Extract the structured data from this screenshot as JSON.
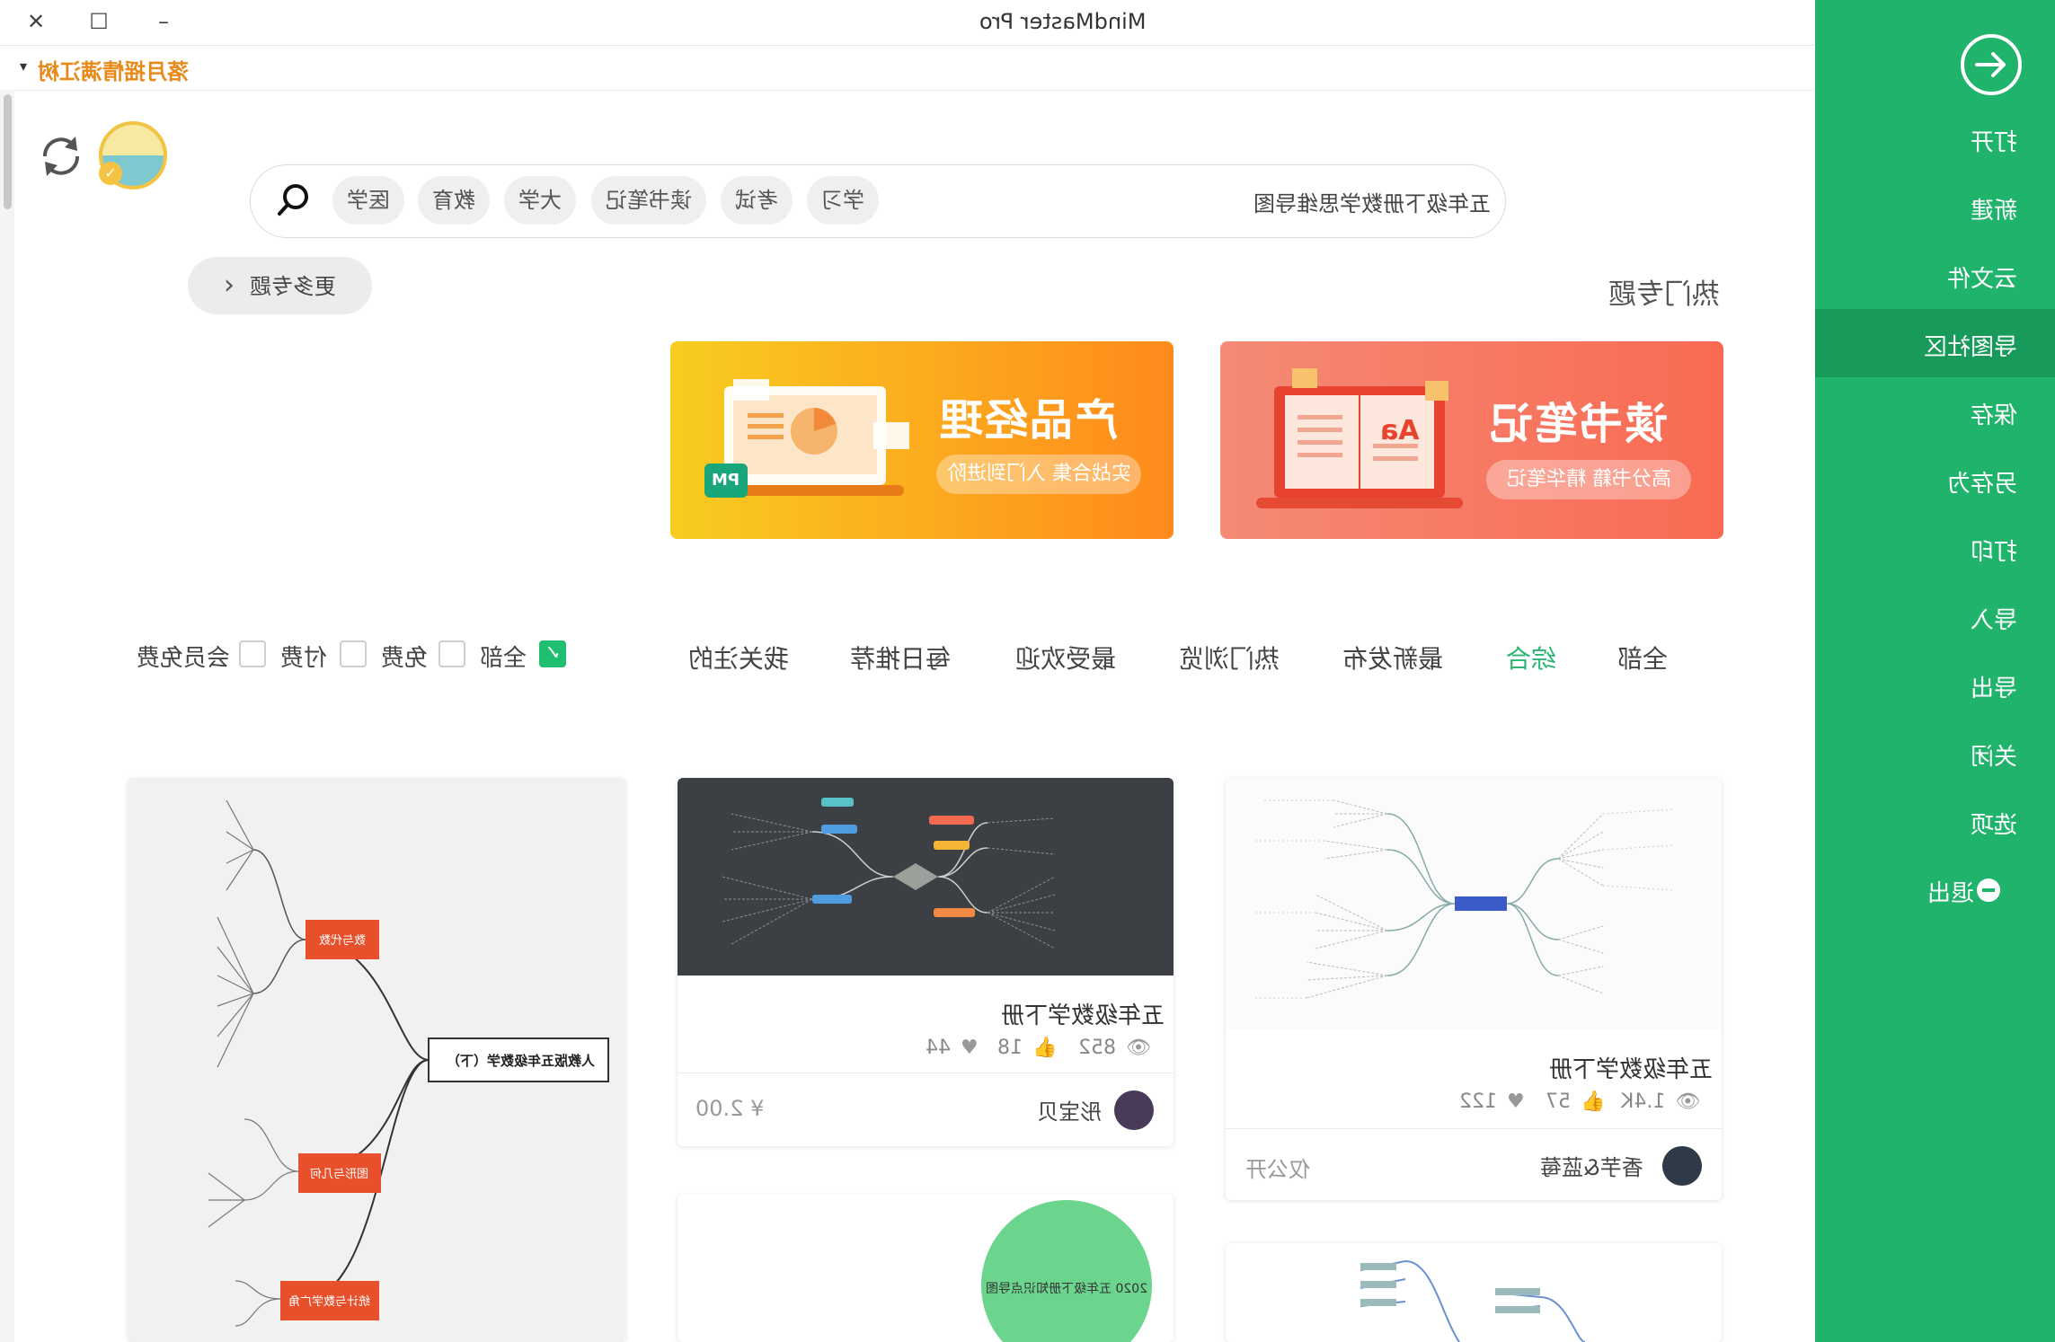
{
  "window": {
    "title": "MindMaster Pro",
    "close_glyph": "✕",
    "maximize_glyph": "☐",
    "minimize_glyph": "–"
  },
  "user": {
    "name": "落月摇情满江树",
    "caret": "▾"
  },
  "search": {
    "query": "五年级下册数学思维导图",
    "tags": [
      "学习",
      "考试",
      "读书笔记",
      "大学",
      "教育",
      "医学"
    ]
  },
  "topics": {
    "heading": "热门专题",
    "more_label": "更多专题",
    "more_chevron": "‹",
    "banners": [
      {
        "title": "读书笔记",
        "subtitle": "高分书籍 精华笔记",
        "icon_text": "Aa",
        "color_start": "#f48a76",
        "color_end": "#f96a52"
      },
      {
        "title": "产品经理",
        "subtitle": "实战合集 入门到进阶",
        "icon_text": "PM",
        "color_start": "#f8cd20",
        "color_end": "#ff8a1c"
      }
    ]
  },
  "tabs": [
    "全部",
    "综合",
    "最新发布",
    "热门浏览",
    "最受欢迎",
    "每日推荐",
    "我关注的"
  ],
  "active_tab_index": 1,
  "filters": [
    {
      "label": "全部",
      "checked": true
    },
    {
      "label": "免费",
      "checked": false
    },
    {
      "label": "付费",
      "checked": false
    },
    {
      "label": "会员免费",
      "checked": false
    }
  ],
  "cards": [
    {
      "title": "五年级数学下册",
      "views": "1.4K",
      "likes": "57",
      "favorites": "122",
      "author": "香芋&蓝莓",
      "price": "仅公开"
    },
    {
      "title": "五年级数学下册",
      "views": "852",
      "likes": "18",
      "favorites": "44",
      "author": "彤宝贝",
      "price": "¥ 2.00"
    },
    {
      "title": "人教版五年级数学（下）",
      "views": "",
      "likes": "",
      "favorites": "",
      "author": "",
      "price": ""
    }
  ],
  "map_labels": {
    "center_3": "人教版五年级数学（下）",
    "nodes_3": [
      "数与代数",
      "图形与几何",
      "统计与数学广角"
    ],
    "circle_4": "2020 五年级下册知识点导图"
  },
  "sidebar": {
    "items": [
      "打开",
      "新建",
      "云文件",
      "导图社区",
      "保存",
      "另存为",
      "打印",
      "导入",
      "导出",
      "关闭",
      "选项",
      "退出"
    ],
    "active_index": 3
  },
  "colors": {
    "accent": "#1fb36b",
    "active_tab": "#2bb673",
    "user_name": "#e88a1a"
  },
  "icons": [
    "sync-icon",
    "search-icon",
    "open-icon",
    "eye-icon",
    "thumb-icon",
    "heart-icon",
    "exit-icon"
  ]
}
